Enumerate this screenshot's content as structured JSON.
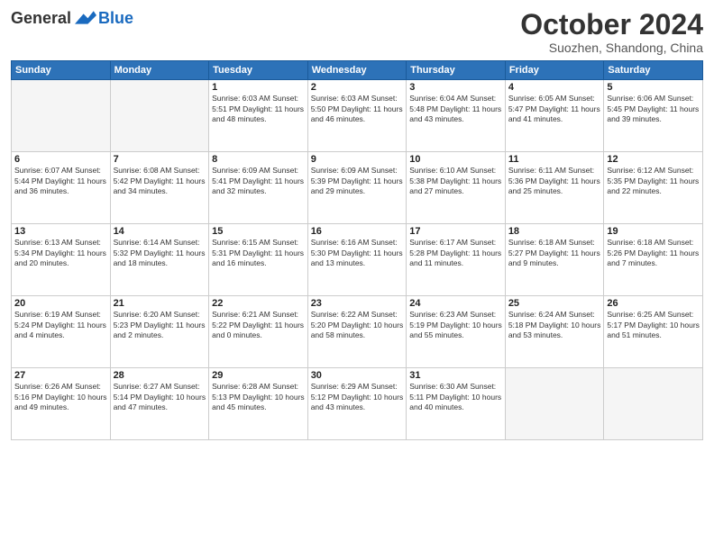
{
  "header": {
    "logo_general": "General",
    "logo_blue": "Blue",
    "month_title": "October 2024",
    "subtitle": "Suozhen, Shandong, China"
  },
  "days_of_week": [
    "Sunday",
    "Monday",
    "Tuesday",
    "Wednesday",
    "Thursday",
    "Friday",
    "Saturday"
  ],
  "weeks": [
    [
      {
        "day": "",
        "info": ""
      },
      {
        "day": "",
        "info": ""
      },
      {
        "day": "1",
        "info": "Sunrise: 6:03 AM\nSunset: 5:51 PM\nDaylight: 11 hours and 48 minutes."
      },
      {
        "day": "2",
        "info": "Sunrise: 6:03 AM\nSunset: 5:50 PM\nDaylight: 11 hours and 46 minutes."
      },
      {
        "day": "3",
        "info": "Sunrise: 6:04 AM\nSunset: 5:48 PM\nDaylight: 11 hours and 43 minutes."
      },
      {
        "day": "4",
        "info": "Sunrise: 6:05 AM\nSunset: 5:47 PM\nDaylight: 11 hours and 41 minutes."
      },
      {
        "day": "5",
        "info": "Sunrise: 6:06 AM\nSunset: 5:45 PM\nDaylight: 11 hours and 39 minutes."
      }
    ],
    [
      {
        "day": "6",
        "info": "Sunrise: 6:07 AM\nSunset: 5:44 PM\nDaylight: 11 hours and 36 minutes."
      },
      {
        "day": "7",
        "info": "Sunrise: 6:08 AM\nSunset: 5:42 PM\nDaylight: 11 hours and 34 minutes."
      },
      {
        "day": "8",
        "info": "Sunrise: 6:09 AM\nSunset: 5:41 PM\nDaylight: 11 hours and 32 minutes."
      },
      {
        "day": "9",
        "info": "Sunrise: 6:09 AM\nSunset: 5:39 PM\nDaylight: 11 hours and 29 minutes."
      },
      {
        "day": "10",
        "info": "Sunrise: 6:10 AM\nSunset: 5:38 PM\nDaylight: 11 hours and 27 minutes."
      },
      {
        "day": "11",
        "info": "Sunrise: 6:11 AM\nSunset: 5:36 PM\nDaylight: 11 hours and 25 minutes."
      },
      {
        "day": "12",
        "info": "Sunrise: 6:12 AM\nSunset: 5:35 PM\nDaylight: 11 hours and 22 minutes."
      }
    ],
    [
      {
        "day": "13",
        "info": "Sunrise: 6:13 AM\nSunset: 5:34 PM\nDaylight: 11 hours and 20 minutes."
      },
      {
        "day": "14",
        "info": "Sunrise: 6:14 AM\nSunset: 5:32 PM\nDaylight: 11 hours and 18 minutes."
      },
      {
        "day": "15",
        "info": "Sunrise: 6:15 AM\nSunset: 5:31 PM\nDaylight: 11 hours and 16 minutes."
      },
      {
        "day": "16",
        "info": "Sunrise: 6:16 AM\nSunset: 5:30 PM\nDaylight: 11 hours and 13 minutes."
      },
      {
        "day": "17",
        "info": "Sunrise: 6:17 AM\nSunset: 5:28 PM\nDaylight: 11 hours and 11 minutes."
      },
      {
        "day": "18",
        "info": "Sunrise: 6:18 AM\nSunset: 5:27 PM\nDaylight: 11 hours and 9 minutes."
      },
      {
        "day": "19",
        "info": "Sunrise: 6:18 AM\nSunset: 5:26 PM\nDaylight: 11 hours and 7 minutes."
      }
    ],
    [
      {
        "day": "20",
        "info": "Sunrise: 6:19 AM\nSunset: 5:24 PM\nDaylight: 11 hours and 4 minutes."
      },
      {
        "day": "21",
        "info": "Sunrise: 6:20 AM\nSunset: 5:23 PM\nDaylight: 11 hours and 2 minutes."
      },
      {
        "day": "22",
        "info": "Sunrise: 6:21 AM\nSunset: 5:22 PM\nDaylight: 11 hours and 0 minutes."
      },
      {
        "day": "23",
        "info": "Sunrise: 6:22 AM\nSunset: 5:20 PM\nDaylight: 10 hours and 58 minutes."
      },
      {
        "day": "24",
        "info": "Sunrise: 6:23 AM\nSunset: 5:19 PM\nDaylight: 10 hours and 55 minutes."
      },
      {
        "day": "25",
        "info": "Sunrise: 6:24 AM\nSunset: 5:18 PM\nDaylight: 10 hours and 53 minutes."
      },
      {
        "day": "26",
        "info": "Sunrise: 6:25 AM\nSunset: 5:17 PM\nDaylight: 10 hours and 51 minutes."
      }
    ],
    [
      {
        "day": "27",
        "info": "Sunrise: 6:26 AM\nSunset: 5:16 PM\nDaylight: 10 hours and 49 minutes."
      },
      {
        "day": "28",
        "info": "Sunrise: 6:27 AM\nSunset: 5:14 PM\nDaylight: 10 hours and 47 minutes."
      },
      {
        "day": "29",
        "info": "Sunrise: 6:28 AM\nSunset: 5:13 PM\nDaylight: 10 hours and 45 minutes."
      },
      {
        "day": "30",
        "info": "Sunrise: 6:29 AM\nSunset: 5:12 PM\nDaylight: 10 hours and 43 minutes."
      },
      {
        "day": "31",
        "info": "Sunrise: 6:30 AM\nSunset: 5:11 PM\nDaylight: 10 hours and 40 minutes."
      },
      {
        "day": "",
        "info": ""
      },
      {
        "day": "",
        "info": ""
      }
    ]
  ]
}
